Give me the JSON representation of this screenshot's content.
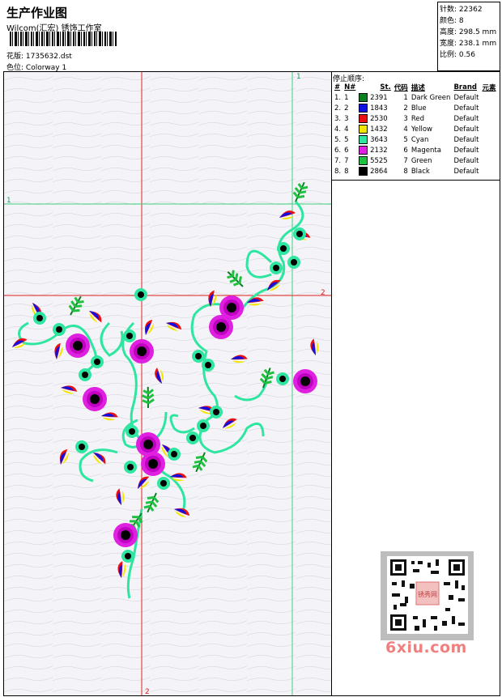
{
  "header": {
    "title": "生产作业图",
    "studio": "Wilcom(汇宏) 锈饰工作室",
    "pattern_label": "花版:",
    "pattern_value": "1735632.dst",
    "colorway_label": "色位:",
    "colorway_value": "Colorway 1"
  },
  "specs": {
    "stitches_label": "针数:",
    "stitches_value": "22362",
    "colors_label": "颜色:",
    "colors_value": "8",
    "height_label": "高度:",
    "height_value": "298.5 mm",
    "width_label": "宽度:",
    "width_value": "238.1 mm",
    "scale_label": "比例:",
    "scale_value": "0.56"
  },
  "guides": {
    "v1_label": "1",
    "h1_label": "1",
    "h2_label": "2",
    "v2_label": "2"
  },
  "stop_sequence": {
    "title": "停止顺序:",
    "headers": [
      "#",
      "N#",
      "St.",
      "代码",
      "描述",
      "Brand",
      "元素"
    ],
    "rows": [
      {
        "num": "1.",
        "n": "1",
        "color": "#0a7f22",
        "st": "2391",
        "code": "1",
        "desc": "Dark Green",
        "brand": "Default"
      },
      {
        "num": "2.",
        "n": "2",
        "color": "#1010e0",
        "st": "1843",
        "code": "2",
        "desc": "Blue",
        "brand": "Default"
      },
      {
        "num": "3.",
        "n": "3",
        "color": "#e81010",
        "st": "2530",
        "code": "3",
        "desc": "Red",
        "brand": "Default"
      },
      {
        "num": "4.",
        "n": "4",
        "color": "#f2e600",
        "st": "1432",
        "code": "4",
        "desc": "Yellow",
        "brand": "Default"
      },
      {
        "num": "5.",
        "n": "5",
        "color": "#2ee6a0",
        "st": "3643",
        "code": "5",
        "desc": "Cyan",
        "brand": "Default"
      },
      {
        "num": "6.",
        "n": "6",
        "color": "#e020e0",
        "st": "2132",
        "code": "6",
        "desc": "Magenta",
        "brand": "Default"
      },
      {
        "num": "7.",
        "n": "7",
        "color": "#20c040",
        "st": "5525",
        "code": "7",
        "desc": "Green",
        "brand": "Default"
      },
      {
        "num": "8.",
        "n": "8",
        "color": "#000000",
        "st": "2864",
        "code": "8",
        "desc": "Black",
        "brand": "Default"
      }
    ]
  },
  "watermark": "6xiu.com",
  "qr_badge": "锈秀网"
}
